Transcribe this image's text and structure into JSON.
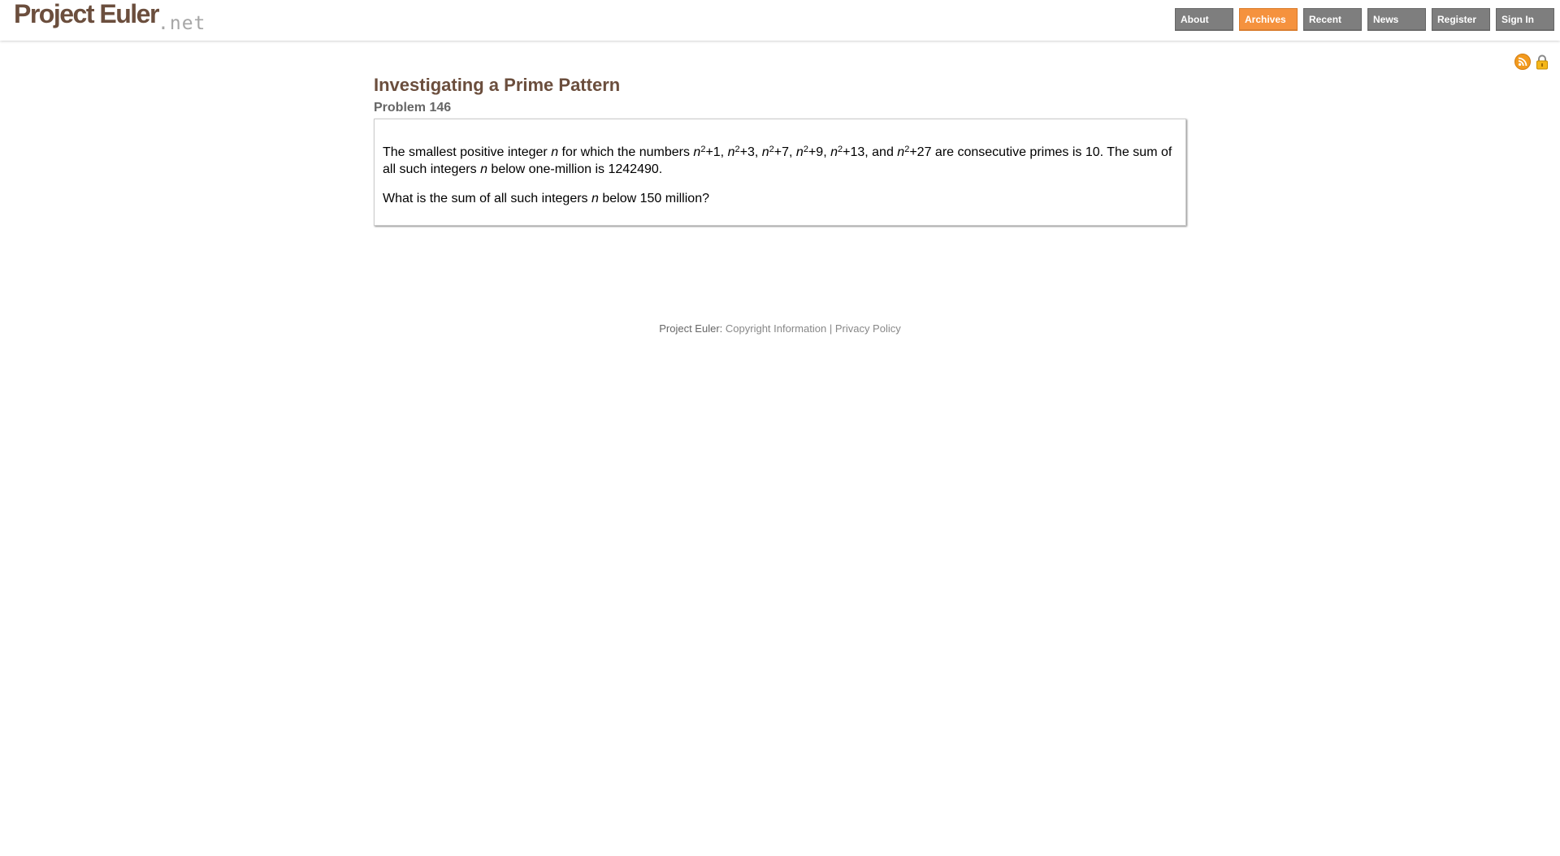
{
  "header": {
    "logo_main": "Project Euler",
    "logo_suffix": ".net",
    "nav": [
      {
        "label": "About",
        "active": false
      },
      {
        "label": "Archives",
        "active": true
      },
      {
        "label": "Recent",
        "active": false
      },
      {
        "label": "News",
        "active": false
      },
      {
        "label": "Register",
        "active": false
      },
      {
        "label": "Sign In",
        "active": false
      }
    ],
    "icons": [
      "rss-icon",
      "lock-icon"
    ],
    "colors": {
      "brand": "#6b4e3d",
      "nav_bg": "#7e7e7e",
      "nav_active": "#f5923e"
    }
  },
  "problem": {
    "title": "Investigating a Prime Pattern",
    "number": "Problem 146",
    "p1": {
      "t1": "The smallest positive integer ",
      "var": "n",
      "t2": " for which the numbers ",
      "exp": "2",
      "terms": [
        "+1, ",
        "+3, ",
        "+7, ",
        "+9, ",
        "+13, and ",
        "+27"
      ],
      "t3": " are consecutive primes is 10. The sum of all such integers ",
      "t4": " below one-million is 1242490."
    },
    "p2": {
      "t1": "What is the sum of all such integers ",
      "var": "n",
      "t2": " below 150 million?"
    }
  },
  "footer": {
    "site": "Project Euler:",
    "copyright": "Copyright Information",
    "separator": "|",
    "privacy": "Privacy Policy"
  }
}
